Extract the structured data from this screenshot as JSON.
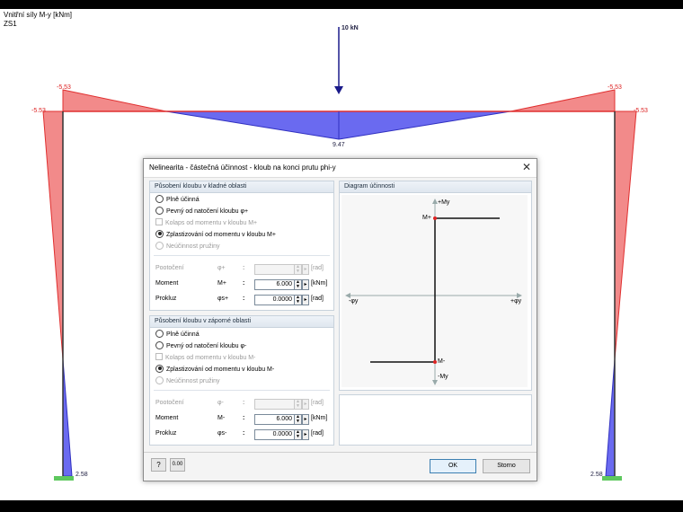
{
  "background": {
    "header_line1": "Vnitřní síly M-y [kNm]",
    "header_line2": "ZS1",
    "load_label": "10 kN",
    "val_left_top": "-5.53",
    "val_left_corner": "-5.53",
    "val_right_top": "-5.53",
    "val_right_corner": "-5.53",
    "val_mid": "9.47",
    "val_base_left": "2.58",
    "val_base_right": "2.58"
  },
  "dialog": {
    "title": "Nelinearita - částečná účinnost - kloub na konci prutu phi-y",
    "positive": {
      "title": "Působení kloubu v kladné oblasti",
      "options": [
        {
          "label": "Plně účinná",
          "state": "radio",
          "selected": false,
          "enabled": true
        },
        {
          "label": "Pevný od natočení kloubu φ+",
          "state": "radio",
          "selected": false,
          "enabled": true
        },
        {
          "label": "Kolaps od momentu v kloubu M+",
          "state": "check",
          "selected": false,
          "enabled": false
        },
        {
          "label": "Zplastizování od momentu v kloubu M+",
          "state": "radio",
          "selected": true,
          "enabled": true
        },
        {
          "label": "Neúčinnost pružiny",
          "state": "radio",
          "selected": false,
          "enabled": false
        }
      ],
      "rot_label": "Pootočení",
      "rot_sym": "φ+",
      "rot_value": "",
      "rot_unit": "[rad]",
      "moment_label": "Moment",
      "moment_sym": "M+",
      "moment_value": "6.000",
      "moment_unit": "[kNm]",
      "slip_label": "Prokluz",
      "slip_sym": "φs+",
      "slip_value": "0.0000",
      "slip_unit": "[rad]"
    },
    "negative": {
      "title": "Působení kloubu v záporné oblasti",
      "options": [
        {
          "label": "Plně účinná",
          "state": "radio",
          "selected": false,
          "enabled": true
        },
        {
          "label": "Pevný od natočení kloubu φ-",
          "state": "radio",
          "selected": false,
          "enabled": true
        },
        {
          "label": "Kolaps od momentu v kloubu M-",
          "state": "check",
          "selected": false,
          "enabled": false
        },
        {
          "label": "Zplastizování od momentu v kloubu M-",
          "state": "radio",
          "selected": true,
          "enabled": true
        },
        {
          "label": "Neúčinnost pružiny",
          "state": "radio",
          "selected": false,
          "enabled": false
        }
      ],
      "rot_label": "Pootočení",
      "rot_sym": "φ-",
      "rot_value": "",
      "rot_unit": "[rad]",
      "moment_label": "Moment",
      "moment_sym": "M-",
      "moment_value": "6.000",
      "moment_unit": "[kNm]",
      "slip_label": "Prokluz",
      "slip_sym": "φs-",
      "slip_value": "0.0000",
      "slip_unit": "[rad]"
    },
    "diagram": {
      "title": "Diagram účinnosti",
      "axis_plus_my": "+My",
      "axis_minus_my": "-My",
      "axis_plus_phi": "+φy",
      "axis_minus_phi": "-φy",
      "m_plus": "M+",
      "m_minus": "M-"
    },
    "buttons": {
      "help_icon": "help-icon",
      "units_icon": "units-icon",
      "ok": "OK",
      "cancel": "Storno"
    }
  }
}
